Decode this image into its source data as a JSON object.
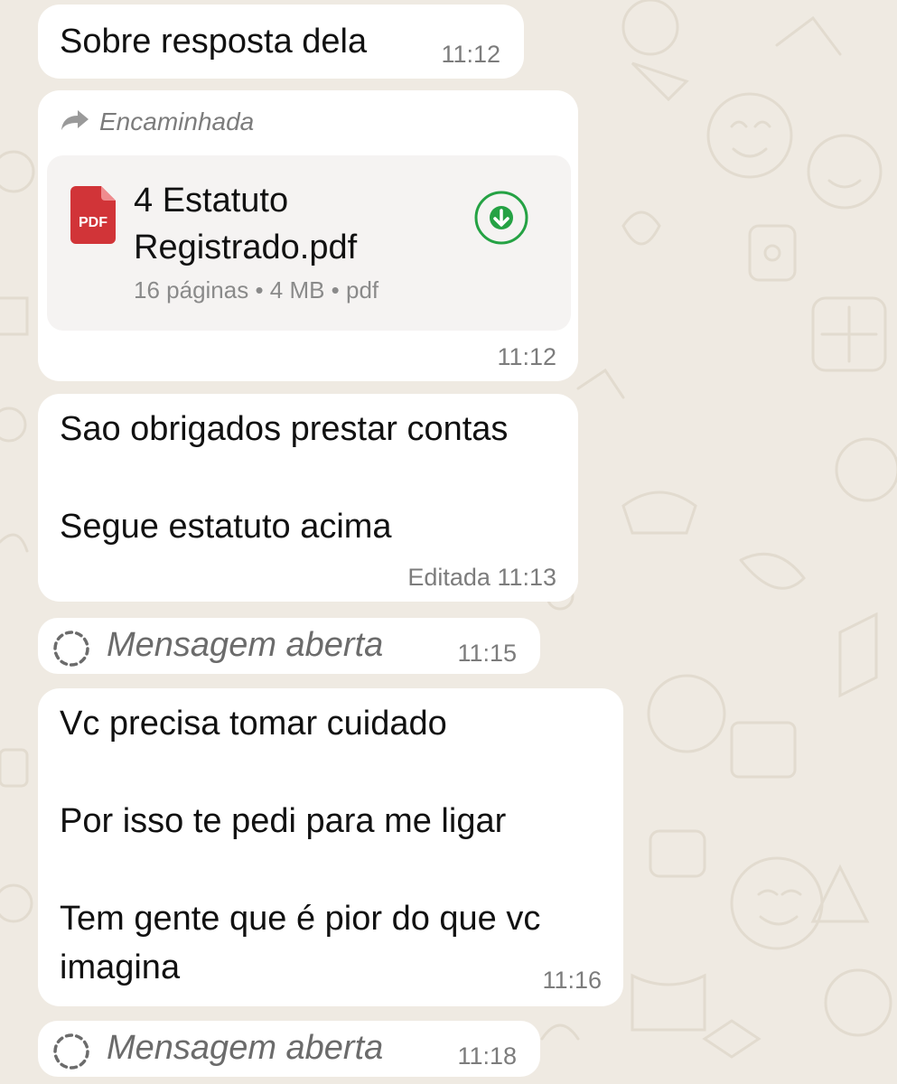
{
  "messages": [
    {
      "text": "Sobre resposta dela",
      "time": "11:12"
    },
    {
      "forwarded_label": "Encaminhada",
      "document": {
        "icon_label": "PDF",
        "name": "4 Estatuto Registrado.pdf",
        "meta": "16 páginas • 4 MB • pdf"
      },
      "time": "11:12"
    },
    {
      "text": "Sao obrigados prestar contas\n\nSegue estatuto acima",
      "edited_label": "Editada",
      "time": "11:13"
    },
    {
      "status_text": "Mensagem aberta",
      "time": "11:15"
    },
    {
      "text": "Vc precisa tomar cuidado\n\nPor isso te pedi para me ligar\n\nTem gente que é pior do que vc imagina",
      "time": "11:16"
    },
    {
      "status_text": "Mensagem aberta",
      "time": "11:18"
    }
  ],
  "icons": {
    "forward": "forward-arrow-icon",
    "document": "pdf-file-icon",
    "download": "download-icon",
    "opened": "view-once-opened-icon"
  },
  "colors": {
    "chat_background": "#efeae2",
    "bubble": "#ffffff",
    "pdf_red": "#d13438",
    "download_green": "#25a244",
    "meta_gray": "#7c7c7c"
  }
}
